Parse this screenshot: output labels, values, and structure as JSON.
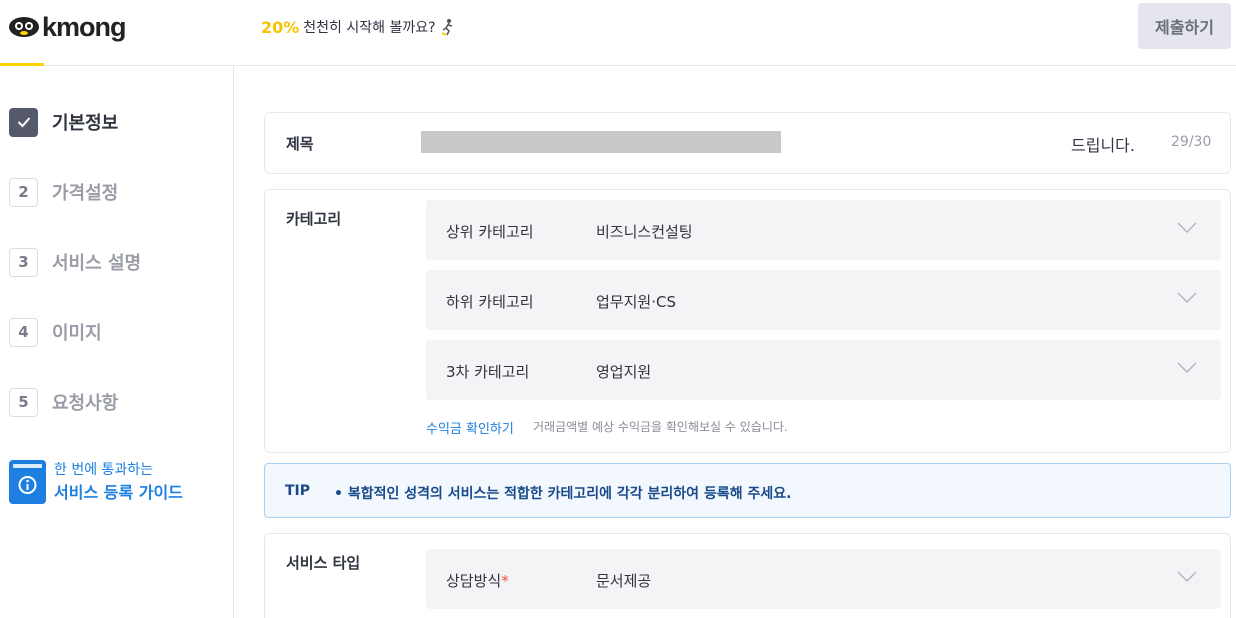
{
  "header": {
    "logo_text": "kmong",
    "promo_percent": "20%",
    "promo_text": "천천히 시작해 볼까요?",
    "submit_label": "제출하기"
  },
  "sidebar": {
    "steps": [
      {
        "num": "",
        "label": "기본정보",
        "state": "done"
      },
      {
        "num": "2",
        "label": "가격설정",
        "state": "todo"
      },
      {
        "num": "3",
        "label": "서비스 설명",
        "state": "todo"
      },
      {
        "num": "4",
        "label": "이미지",
        "state": "todo"
      },
      {
        "num": "5",
        "label": "요청사항",
        "state": "todo"
      }
    ],
    "guide": {
      "line1": "한 번에 통과하는",
      "line2": "서비스 등록 가이드"
    }
  },
  "main": {
    "title_field": {
      "label": "제목",
      "suffix": "드립니다.",
      "count": "29/30"
    },
    "category": {
      "label": "카테고리",
      "rows": [
        {
          "label": "상위 카테고리",
          "value": "비즈니스컨설팅"
        },
        {
          "label": "하위 카테고리",
          "value": "업무지원·CS"
        },
        {
          "label": "3차 카테고리",
          "value": "영업지원"
        }
      ],
      "revenue_link": "수익금 확인하기",
      "revenue_desc": "거래금액별 예상 수익금을 확인해보실 수 있습니다."
    },
    "tip": {
      "label": "TIP",
      "text": "• 복합적인 성격의 서비스는 적합한 카테고리에 각각 분리하여 등록해 주세요."
    },
    "service_type": {
      "label": "서비스 타입",
      "row_label": "상담방식",
      "required_mark": "*",
      "row_value": "문서제공"
    }
  },
  "colors": {
    "brand_yellow": "#ffd400",
    "link_blue": "#1d7fe0",
    "tip_text": "#1a4a8a",
    "required_red": "#f0533f"
  }
}
